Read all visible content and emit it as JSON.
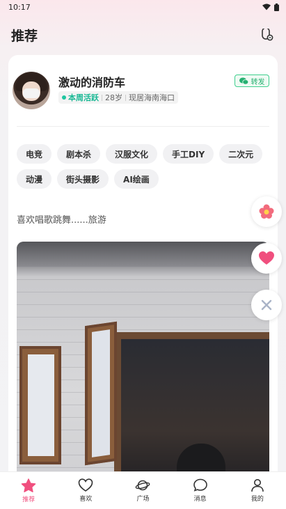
{
  "status_bar": {
    "time": "10:17"
  },
  "header": {
    "title": "推荐"
  },
  "profile": {
    "name": "激动的消防车",
    "activity": "本周活跃",
    "age": "28岁",
    "location": "现居海南海口",
    "wechat_label": "转发"
  },
  "tags": [
    "电竞",
    "剧本杀",
    "汉服文化",
    "手工DIY",
    "二次元",
    "动漫",
    "街头摄影",
    "AI绘画"
  ],
  "bio": "喜欢唱歌跳舞......旅游",
  "tabs": [
    {
      "label": "推荐",
      "icon": "star-icon"
    },
    {
      "label": "喜欢",
      "icon": "heart-outline-icon"
    },
    {
      "label": "广场",
      "icon": "planet-icon"
    },
    {
      "label": "消息",
      "icon": "chat-bubble-icon"
    },
    {
      "label": "我的",
      "icon": "person-icon"
    }
  ],
  "colors": {
    "accent": "#f04f7e",
    "active_green": "#18b894",
    "wechat_green": "#26b071"
  }
}
